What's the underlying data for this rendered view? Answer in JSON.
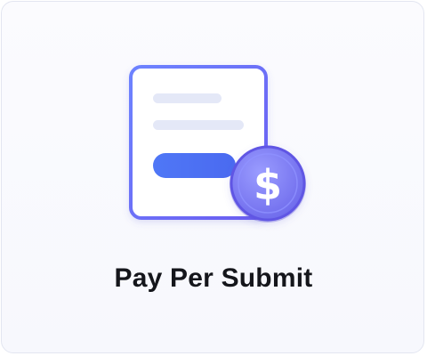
{
  "card": {
    "title": "Pay Per Submit",
    "icon": "document-with-dollar-coin-icon",
    "colors": {
      "accent": "#4f6bf0",
      "coin": "#7c7cf2",
      "title_text": "#15161b",
      "card_border": "#e3e6f1"
    }
  }
}
